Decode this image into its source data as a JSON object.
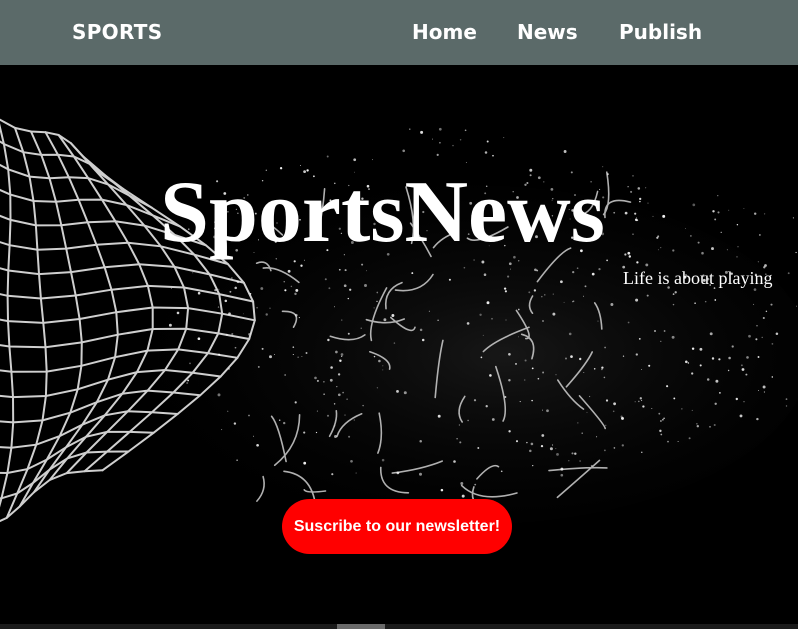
{
  "header": {
    "brand": "SPORTS",
    "nav": [
      {
        "label": "Home"
      },
      {
        "label": "News"
      },
      {
        "label": "Publish"
      }
    ]
  },
  "hero": {
    "title": "SportsNews",
    "tagline": "Life is about playing",
    "cta_label": "Suscribe to our newsletter!"
  },
  "colors": {
    "header_bg": "#5b6a69",
    "hero_bg": "#000000",
    "cta_bg": "#ff0000",
    "text": "#ffffff"
  },
  "icons": {
    "hero_image": "goal-net-burst-image"
  }
}
